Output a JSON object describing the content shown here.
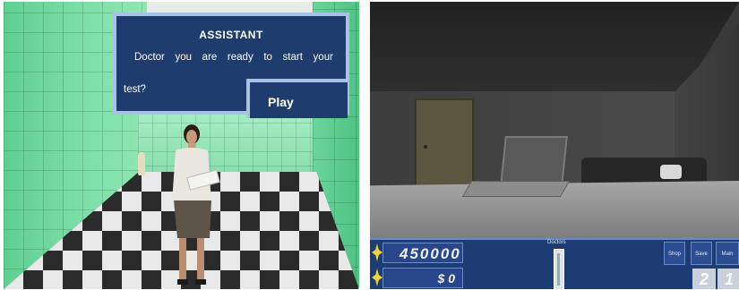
{
  "left_scene": {
    "dialog": {
      "title": "ASSISTANT",
      "line1_words": [
        "Doctor",
        "you",
        "are",
        "ready",
        "to",
        "start",
        "your"
      ],
      "line2": "test?",
      "play_label": "Play"
    }
  },
  "right_scene": {
    "hud": {
      "money": "450000",
      "cash": "$ 0",
      "doctors_label": "Doctors",
      "shop_label": "Shop",
      "save_label": "Save",
      "main_menu_label": "Main Menu",
      "counter_a": "2",
      "counter_b": "1"
    }
  },
  "colors": {
    "dialog_bg": "#1e3d6e",
    "dialog_border": "#a8c2e6",
    "hud_bg": "#1d3c73",
    "tile_green": "#7fe0a8"
  }
}
